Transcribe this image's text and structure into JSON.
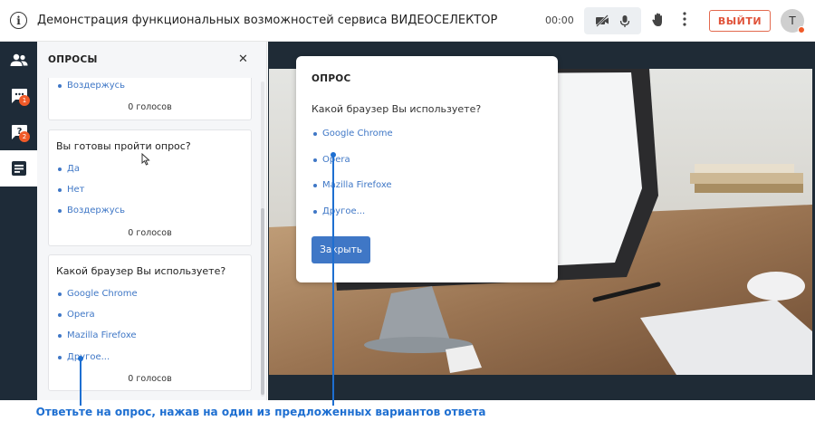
{
  "header": {
    "title": "Демонстрация функциональных возможностей сервиса ВИДЕОСЕЛЕКТОР",
    "timer": "00:00",
    "exit_label": "ВЫЙТИ",
    "avatar_initial": "T"
  },
  "sidebar": {
    "items": [
      {
        "icon": "participants-icon"
      },
      {
        "icon": "chat-icon",
        "badge": "1"
      },
      {
        "icon": "questions-icon",
        "badge": "2"
      },
      {
        "icon": "polls-icon",
        "active": true
      }
    ]
  },
  "polls_panel": {
    "title": "ОПРОСЫ",
    "cards": [
      {
        "question": "",
        "options": [
          "Воздержусь"
        ],
        "votes": "0 голосов"
      },
      {
        "question": "Вы готовы пройти опрос?",
        "options": [
          "Да",
          "Нет",
          "Воздержусь"
        ],
        "votes": "0 голосов"
      },
      {
        "question": "Какой браузер Вы используете?",
        "options": [
          "Google Chrome",
          "Opera",
          "Mazilla Firefoxe",
          "Другое..."
        ],
        "votes": "0 голосов"
      }
    ]
  },
  "poll_modal": {
    "title": "ОПРОС",
    "question": "Какой браузер Вы используете?",
    "options": [
      "Google Chrome",
      "Opera",
      "Mazilla Firefoxe",
      "Другое..."
    ],
    "close_label": "Закрыть"
  },
  "caption": "Ответьте на опрос, нажав на один из предложенных вариантов ответа",
  "colors": {
    "accent": "#3f77c6",
    "sidebar_bg": "#1e2b38",
    "badge": "#f05a28",
    "exit": "#e0533a",
    "caption": "#1e6fd1"
  }
}
